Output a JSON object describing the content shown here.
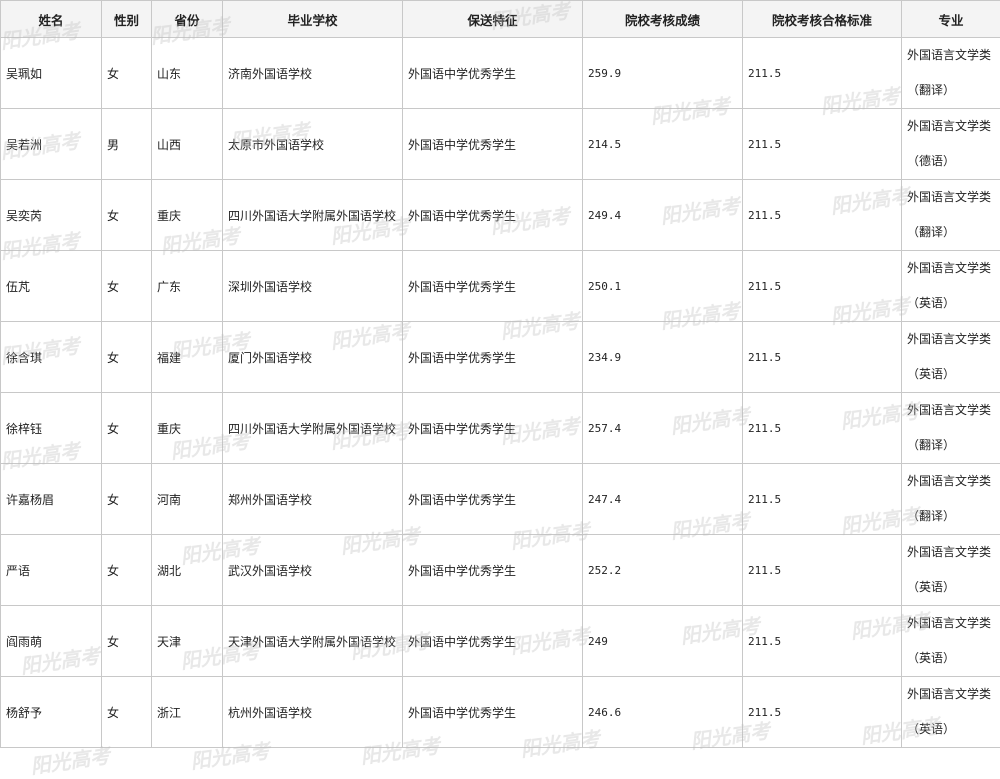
{
  "headers": [
    "姓名",
    "性别",
    "省份",
    "毕业学校",
    "保送特征",
    "院校考核成绩",
    "院校考核合格标准",
    "专业"
  ],
  "rows": [
    {
      "name": "吴珮如",
      "gender": "女",
      "province": "山东",
      "school": "济南外国语学校",
      "feature": "外国语中学优秀学生",
      "score": "259.9",
      "standard": "211.5",
      "major_line1": "外国语言文学类",
      "major_line2": "（翻译）"
    },
    {
      "name": "吴若洲",
      "gender": "男",
      "province": "山西",
      "school": "太原市外国语学校",
      "feature": "外国语中学优秀学生",
      "score": "214.5",
      "standard": "211.5",
      "major_line1": "外国语言文学类",
      "major_line2": "（德语）"
    },
    {
      "name": "吴奕芮",
      "gender": "女",
      "province": "重庆",
      "school": "四川外国语大学附属外国语学校",
      "feature": "外国语中学优秀学生",
      "score": "249.4",
      "standard": "211.5",
      "major_line1": "外国语言文学类",
      "major_line2": "（翻译）"
    },
    {
      "name": "伍芃",
      "gender": "女",
      "province": "广东",
      "school": "深圳外国语学校",
      "feature": "外国语中学优秀学生",
      "score": "250.1",
      "standard": "211.5",
      "major_line1": "外国语言文学类",
      "major_line2": "（英语）"
    },
    {
      "name": "徐含琪",
      "gender": "女",
      "province": "福建",
      "school": "厦门外国语学校",
      "feature": "外国语中学优秀学生",
      "score": "234.9",
      "standard": "211.5",
      "major_line1": "外国语言文学类",
      "major_line2": "（英语）"
    },
    {
      "name": "徐梓钰",
      "gender": "女",
      "province": "重庆",
      "school": "四川外国语大学附属外国语学校",
      "feature": "外国语中学优秀学生",
      "score": "257.4",
      "standard": "211.5",
      "major_line1": "外国语言文学类",
      "major_line2": "（翻译）"
    },
    {
      "name": "许嘉杨眉",
      "gender": "女",
      "province": "河南",
      "school": "郑州外国语学校",
      "feature": "外国语中学优秀学生",
      "score": "247.4",
      "standard": "211.5",
      "major_line1": "外国语言文学类",
      "major_line2": "（翻译）"
    },
    {
      "name": "严语",
      "gender": "女",
      "province": "湖北",
      "school": "武汉外国语学校",
      "feature": "外国语中学优秀学生",
      "score": "252.2",
      "standard": "211.5",
      "major_line1": "外国语言文学类",
      "major_line2": "（英语）"
    },
    {
      "name": "阎雨萌",
      "gender": "女",
      "province": "天津",
      "school": "天津外国语大学附属外国语学校",
      "feature": "外国语中学优秀学生",
      "score": "249",
      "standard": "211.5",
      "major_line1": "外国语言文学类",
      "major_line2": "（英语）"
    },
    {
      "name": "杨舒予",
      "gender": "女",
      "province": "浙江",
      "school": "杭州外国语学校",
      "feature": "外国语中学优秀学生",
      "score": "246.6",
      "standard": "211.5",
      "major_line1": "外国语言文学类",
      "major_line2": "（英语）"
    }
  ],
  "watermark": "阳光高考"
}
